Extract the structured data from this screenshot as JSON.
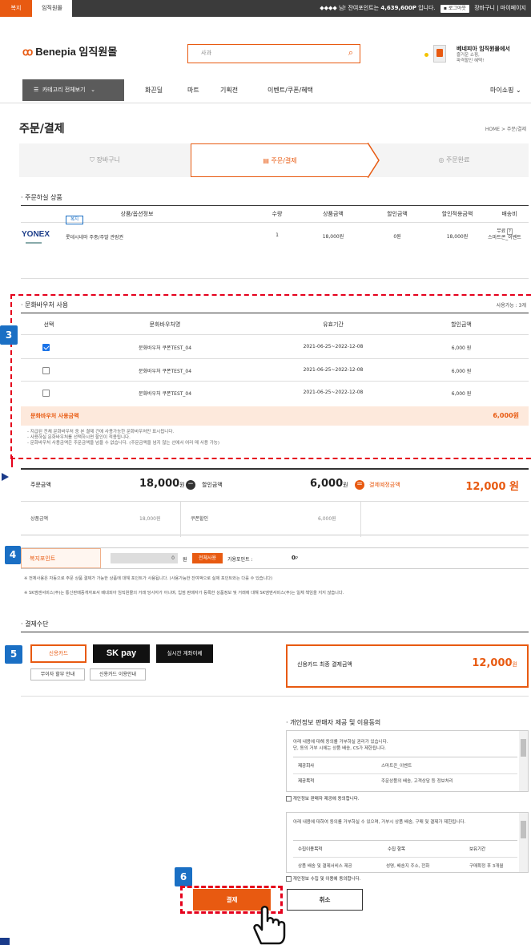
{
  "topbar": {
    "tab_bokji": "복지",
    "tab_imjik": "임직원몰",
    "user_mask": "◆◆◆◆",
    "user_suffix": "님! 잔여포인트는",
    "points": "4,639,600P",
    "points_suffix": "입니다.",
    "logout": "로그아웃",
    "cart": "장바구니",
    "mypage": "마이페이지"
  },
  "header": {
    "logo_text": "Benepia 임직원몰",
    "search_value": "사과",
    "promo_title": "베네피아 임직원몰에서",
    "promo_line1": "즐거운 쇼핑,",
    "promo_line2": "파격할인 혜택!"
  },
  "nav": {
    "category_button": "카테고리 전체보기",
    "items": [
      "화끈딜",
      "마트",
      "기획전",
      "이벤트/쿠폰/혜택"
    ],
    "myshopping": "마이쇼핑"
  },
  "page": {
    "title": "주문/결제",
    "breadcrumb": "HOME  >  주문/결제"
  },
  "steps": [
    {
      "label": "장바구니",
      "icon": "cart-icon"
    },
    {
      "label": "주문/결제",
      "icon": "clipboard-icon"
    },
    {
      "label": "주문완료",
      "icon": "check-circle-icon"
    }
  ],
  "order_section": {
    "title": "· 주문하실 상품",
    "headers": [
      "상품/옵션정보",
      "수량",
      "상품금액",
      "할인금액",
      "할인적용금액",
      "배송비"
    ],
    "item": {
      "brand": "YONEX",
      "tag": "복지",
      "name": "롯데시네마 주중/주말 관람권",
      "qty": "1",
      "price": "18,000원",
      "discount": "0원",
      "final": "18,000원",
      "shipping_line1": "무료",
      "shipping_line2": "스마트콘_이벤트"
    }
  },
  "voucher_section": {
    "title": "· 문화바우처 사용",
    "available": "사용가능 : 3개",
    "headers": [
      "선택",
      "문화바우처명",
      "유효기간",
      "할인금액"
    ],
    "rows": [
      {
        "name": "문화바우처 쿠폰TEST_04",
        "period": "2021-06-25~2022-12-08",
        "amount": "6,000 원",
        "checked": true
      },
      {
        "name": "문화바우처 쿠폰TEST_04",
        "period": "2021-06-25~2022-12-08",
        "amount": "6,000 원",
        "checked": false
      },
      {
        "name": "문화바우처 쿠폰TEST_04",
        "period": "2021-06-25~2022-12-08",
        "amount": "6,000 원",
        "checked": false
      }
    ],
    "total_label": "문화바우처 사용금액",
    "total_value": "6,000원",
    "notes": [
      "- 지급된 전체 문화바우처 중 본 결제 건에 사용가능한 문화바우처만 표시됩니다.",
      "- 사용하실 문화바우처를 선택하시면 할인이 적용됩니다.",
      "- 문화바우처 사용금액은 주문금액을 넘을 수 없습니다. (주문금액을 넘지 않는 선에서 여러 매 사용 가능)"
    ]
  },
  "summary": {
    "order_label": "주문금액",
    "order_value": "18,000",
    "won": "원",
    "discount_label": "할인금액",
    "discount_value": "6,000",
    "pay_label": "결제예정금액",
    "pay_value": "12,000 원",
    "minus": "−",
    "equals": "=",
    "product_label": "상품금액",
    "product_value": "18,000원",
    "coupon_label": "쿠폰할인",
    "coupon_value": "6,000원"
  },
  "welfare": {
    "label": "복지포인트",
    "input_value": "0",
    "won": "원",
    "use_all": "전체사용",
    "available_label": "가용포인트 :",
    "available_value": "0",
    "p": "P",
    "note1": "※ 전체사용은 자동으로 주문 상품 결제가 가능한 상품에 대해 포인트가 사용됩니다. (사용가능한 잔여액으로 실제 포인트와는 다를 수 있습니다)",
    "note2": "※ SK엠엔서비스(주)는 통신판매중개자로서 베네피아 임직원몰의 거래 당사자가 아니며, 입점 판매자가 등록한 상품정보 및 거래에 대해 SK엠엔서비스(주)는 일체 책임을 지지 않습니다."
  },
  "payment": {
    "title": "· 결제수단",
    "credit": "신용카드",
    "skpay": "SK pay",
    "realtime": "실시간 계좌이체",
    "installment": "무이자 할부 안내",
    "card_guide": "신용카드 이용안내",
    "final_label": "신용카드 최종 결제금액",
    "final_value": "12,000",
    "won": "원"
  },
  "consent": {
    "title": "· 개인정보 판매자 제공 및 이용동의",
    "box1_line1": "아래 내용에 대해 동의를 거부하실 권리가 있습니다.",
    "box1_line2": "단, 동의 거부 시에는 상품 배송, CS가 제한됩니다.",
    "box1_r1_k": "제공회사",
    "box1_r1_v": "스마트콘_이벤트",
    "box1_r2_k": "제공목적",
    "box1_r2_v": "주문상품의 배송, 고객상담 등 정보처리",
    "check1": "개인정보 판매자 제공에 동의합니다.",
    "box2_line1": "아래 내용에 대하여 동의를 거부하실 수 있으며, 거부시 상품 배송, 구매 및 결제가 제한됩니다.",
    "box2_h1": "수집이용목적",
    "box2_h2": "수집 항목",
    "box2_h3": "보유기간",
    "box2_r1": "상품 배송 및 결제서비스 제공",
    "box2_r2": "성명, 배송지 주소, 전화",
    "box2_r3": "구매확정 후 3개월",
    "check2": "개인정보 수집 및 이용에 동의합니다."
  },
  "actions": {
    "pay": "결제",
    "cancel": "취소"
  },
  "badges": [
    "3",
    "4",
    "5",
    "6"
  ],
  "colors": {
    "accent": "#e85a11",
    "badge": "#1a6fc4",
    "highlight": "#e5001c"
  }
}
